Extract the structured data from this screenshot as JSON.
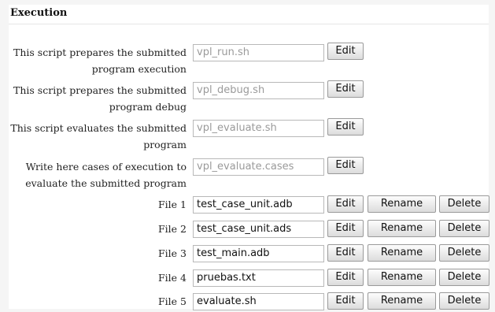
{
  "section": {
    "title": "Execution"
  },
  "scripts": [
    {
      "label_line1": "This script prepares the submitted",
      "label_line2": "program execution",
      "placeholder": "vpl_run.sh",
      "edit_label": "Edit"
    },
    {
      "label_line1": "This script prepares the submitted",
      "label_line2": "program debug",
      "placeholder": "vpl_debug.sh",
      "edit_label": "Edit"
    },
    {
      "label_line1": "This script evaluates the submitted",
      "label_line2": "program",
      "placeholder": "vpl_evaluate.sh",
      "edit_label": "Edit"
    },
    {
      "label_line1": "Write here cases of execution to",
      "label_line2": "evaluate the submitted program",
      "placeholder": "vpl_evaluate.cases",
      "edit_label": "Edit"
    }
  ],
  "files": [
    {
      "label": "File 1",
      "value": "test_case_unit.adb",
      "edit_label": "Edit",
      "rename_label": "Rename",
      "delete_label": "Delete"
    },
    {
      "label": "File 2",
      "value": "test_case_unit.ads",
      "edit_label": "Edit",
      "rename_label": "Rename",
      "delete_label": "Delete"
    },
    {
      "label": "File 3",
      "value": "test_main.adb",
      "edit_label": "Edit",
      "rename_label": "Rename",
      "delete_label": "Delete"
    },
    {
      "label": "File 4",
      "value": "pruebas.txt",
      "edit_label": "Edit",
      "rename_label": "Rename",
      "delete_label": "Delete"
    },
    {
      "label": "File 5",
      "value": "evaluate.sh",
      "edit_label": "Edit",
      "rename_label": "Rename",
      "delete_label": "Delete"
    }
  ]
}
